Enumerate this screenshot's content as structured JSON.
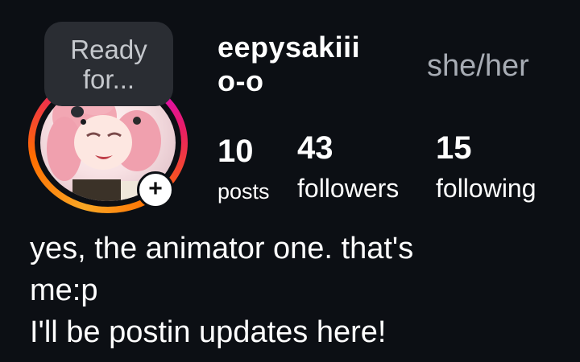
{
  "tooltip": {
    "text": "Ready for..."
  },
  "profile": {
    "username": "eepysakiii o-o",
    "pronouns": "she/her"
  },
  "stats": {
    "posts": {
      "count": "10",
      "label": "posts"
    },
    "followers": {
      "count": "43",
      "label": "followers"
    },
    "following": {
      "count": "15",
      "label": "following"
    }
  },
  "avatar": {
    "add_icon": "plus-icon"
  },
  "bio": {
    "lines": [
      "yes, the animator one. that's",
      "me:p",
      "I'll be postin updates here!"
    ]
  },
  "colors": {
    "background": "#0c0f14",
    "tooltip_bg": "#2a2d33",
    "pronouns": "#a7acb4",
    "story_ring": [
      "#f9a825",
      "#ff6d00",
      "#e91e63",
      "#d500f9"
    ]
  }
}
